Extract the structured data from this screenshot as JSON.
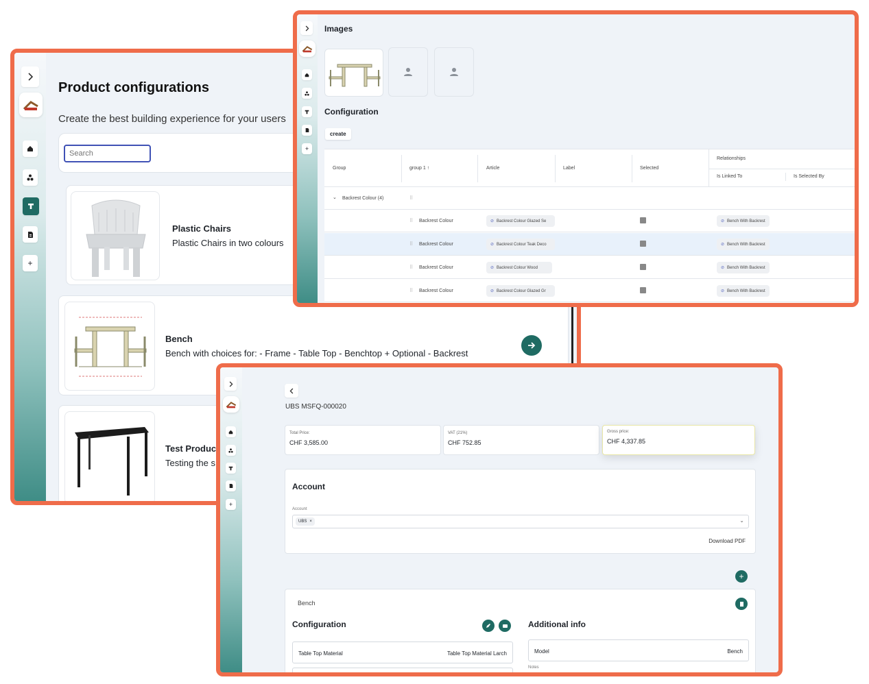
{
  "colors": {
    "frame": "#ef6c4a",
    "accent": "#1f6b63",
    "sidebar_bottom": "#3f8d86",
    "background": "#eff3f8"
  },
  "catalog": {
    "title": "Product configurations",
    "subtitle": "Create the best building experience for your users",
    "search_placeholder": "Search",
    "sidebar_icons": [
      "chevron-right-icon",
      "home-icon",
      "cluster-icon",
      "type-icon",
      "document-icon",
      "plus-icon"
    ],
    "products": [
      {
        "name": "Plastic Chairs",
        "description": "Plastic Chairs in two colours"
      },
      {
        "name": "Bench",
        "description": "Bench with choices for: - Frame - Table Top - Benchtop + Optional - Backrest"
      },
      {
        "name": "Test Produc",
        "description": "Testing the s"
      }
    ]
  },
  "editor": {
    "images_title": "Images",
    "configuration_title": "Configuration",
    "create_label": "create",
    "columns": {
      "group": "Group",
      "group1": "group 1",
      "article": "Article",
      "label": "Label",
      "selected": "Selected",
      "relationships": "Relationships",
      "is_linked_to": "Is Linked To",
      "is_selected_by": "Is Selected By"
    },
    "group_row": "Backrest Colour (4)",
    "rows": [
      {
        "group1": "Backrest Colour",
        "article": "Backrest Colour Glazed Se",
        "linked": "Bench With Backrest"
      },
      {
        "group1": "Backrest Colour",
        "article": "Backrest Colour Teak Deco",
        "linked": "Bench With Backrest"
      },
      {
        "group1": "Backrest Colour",
        "article": "Backrest Colour Wood",
        "linked": "Bench With Backrest"
      },
      {
        "group1": "Backrest Colour",
        "article": "Backrest Colour Glazed Gr",
        "linked": "Bench With Backrest"
      }
    ]
  },
  "order": {
    "order_id": "UBS MSFQ-000020",
    "prices": [
      {
        "label": "Total Price:",
        "value": "CHF 3,585.00"
      },
      {
        "label": "VAT (21%)",
        "value": "CHF 752.85"
      },
      {
        "label": "Gross price:",
        "value": "CHF 4,337.85"
      }
    ],
    "account": {
      "title": "Account",
      "field_label": "Account",
      "tag": "UBS",
      "download": "Download PDF"
    },
    "product_name": "Bench",
    "configuration_title": "Configuration",
    "additional_title": "Additional info",
    "config_row": {
      "label": "Table Top Material",
      "value": "Table Top Material Larch"
    },
    "model_row": {
      "label": "Model",
      "value": "Bench"
    },
    "notes_label": "Notes"
  }
}
